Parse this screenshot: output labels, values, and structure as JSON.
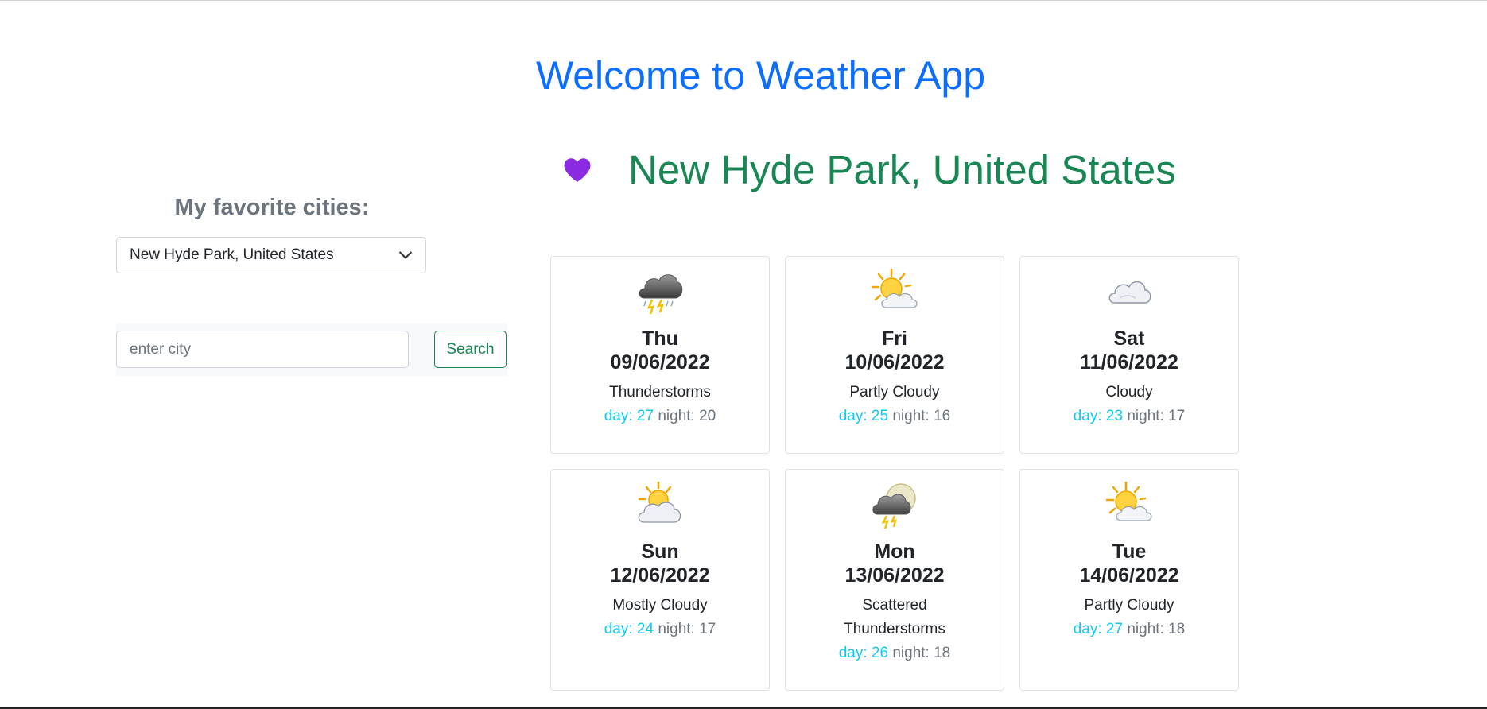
{
  "header": {
    "title": "Welcome to Weather App"
  },
  "favorites": {
    "title": "My favorite cities:",
    "selected": "New Hyde Park, United States"
  },
  "search": {
    "placeholder": "enter city",
    "value": "",
    "button_label": "Search"
  },
  "city": {
    "name": "New Hyde Park, United States",
    "favorite_icon": "heart-icon",
    "favorite_color": "#8a2be2"
  },
  "colors": {
    "title": "#0d6efd",
    "city": "#198754",
    "day_temp": "#0dcaf0",
    "night_temp": "#6c757d"
  },
  "forecast": [
    {
      "day": "Thu",
      "date": "09/06/2022",
      "condition": "Thunderstorms",
      "icon": "thunderstorm-icon",
      "day_temp": "day: 27",
      "night_temp": "night: 20"
    },
    {
      "day": "Fri",
      "date": "10/06/2022",
      "condition": "Partly Cloudy",
      "icon": "partly-cloudy-icon",
      "day_temp": "day: 25",
      "night_temp": "night: 16"
    },
    {
      "day": "Sat",
      "date": "11/06/2022",
      "condition": "Cloudy",
      "icon": "cloudy-icon",
      "day_temp": "day: 23",
      "night_temp": "night: 17"
    },
    {
      "day": "Sun",
      "date": "12/06/2022",
      "condition": "Mostly Cloudy",
      "icon": "mostly-cloudy-icon",
      "day_temp": "day: 24",
      "night_temp": "night: 17"
    },
    {
      "day": "Mon",
      "date": "13/06/2022",
      "condition": "Scattered Thunderstorms",
      "icon": "scattered-thunderstorms-icon",
      "day_temp": "day: 26",
      "night_temp": "night: 18"
    },
    {
      "day": "Tue",
      "date": "14/06/2022",
      "condition": "Partly Cloudy",
      "icon": "partly-cloudy-icon",
      "day_temp": "day: 27",
      "night_temp": "night: 18"
    }
  ]
}
